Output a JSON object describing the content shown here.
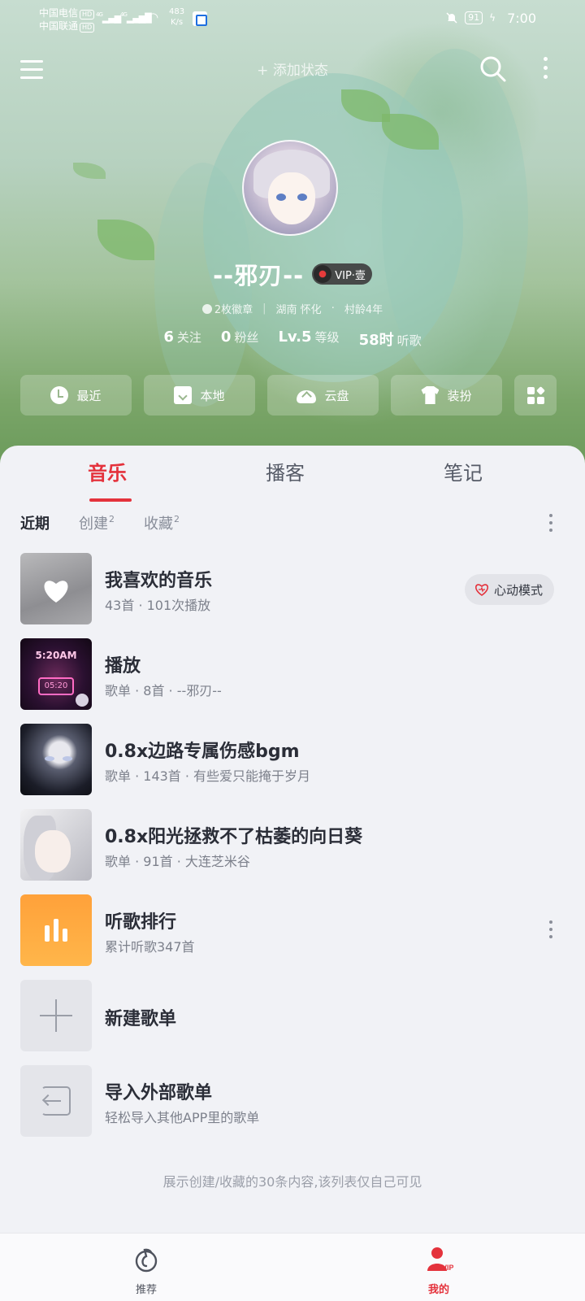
{
  "status_bar": {
    "carrier1": "中国电信",
    "carrier2": "中国联通",
    "hd": "HD",
    "net1": "4G",
    "net2": "4G",
    "speed_value": "483",
    "speed_unit": "K/s",
    "battery": "91",
    "time": "7:00"
  },
  "header": {
    "add_status": "+ 添加状态"
  },
  "profile": {
    "username": "--邪刃--",
    "vip_label": "VIP·壹",
    "badges": "2枚徽章",
    "location": "湖南 怀化",
    "dot": "·",
    "village_age": "村龄4年",
    "stats": [
      {
        "num": "6",
        "label": "关注"
      },
      {
        "num": "0",
        "label": "粉丝"
      },
      {
        "num": "Lv.5",
        "label": "等级"
      },
      {
        "num": "58时",
        "label": "听歌"
      }
    ]
  },
  "quick_actions": [
    {
      "label": "最近",
      "icon": "clock-icon"
    },
    {
      "label": "本地",
      "icon": "download-box-icon"
    },
    {
      "label": "云盘",
      "icon": "cloud-upload-icon"
    },
    {
      "label": "装扮",
      "icon": "shirt-icon"
    }
  ],
  "tabs": [
    "音乐",
    "播客",
    "笔记"
  ],
  "subtabs": [
    {
      "label": "近期",
      "count": ""
    },
    {
      "label": "创建",
      "count": "2"
    },
    {
      "label": "收藏",
      "count": "2"
    }
  ],
  "playlists": [
    {
      "title": "我喜欢的音乐",
      "sub": "43首 · 101次播放"
    },
    {
      "title": "播放",
      "sub": "歌单 · 8首 · --邪刃--"
    },
    {
      "title": "0.8x边路专属伤感bgm",
      "sub": "歌单 · 143首 · 有些爱只能掩于岁月"
    },
    {
      "title": "0.8x阳光拯救不了枯萎的向日葵",
      "sub": "歌单 · 91首 · 大连芝米谷"
    },
    {
      "title": "听歌排行",
      "sub": "累计听歌347首"
    },
    {
      "title": "新建歌单",
      "sub": ""
    },
    {
      "title": "导入外部歌单",
      "sub": "轻松导入其他APP里的歌单"
    }
  ],
  "play_cover": {
    "clock": "5:20AM",
    "screen": "05:20"
  },
  "heart_mode_label": "心动模式",
  "footer_note": "展示创建/收藏的30条内容,该列表仅自己可见",
  "bottom_nav": [
    {
      "label": "推荐"
    },
    {
      "label": "我的"
    }
  ],
  "colors": {
    "accent": "#e4323c",
    "rank_cover": "#ffa13a"
  }
}
